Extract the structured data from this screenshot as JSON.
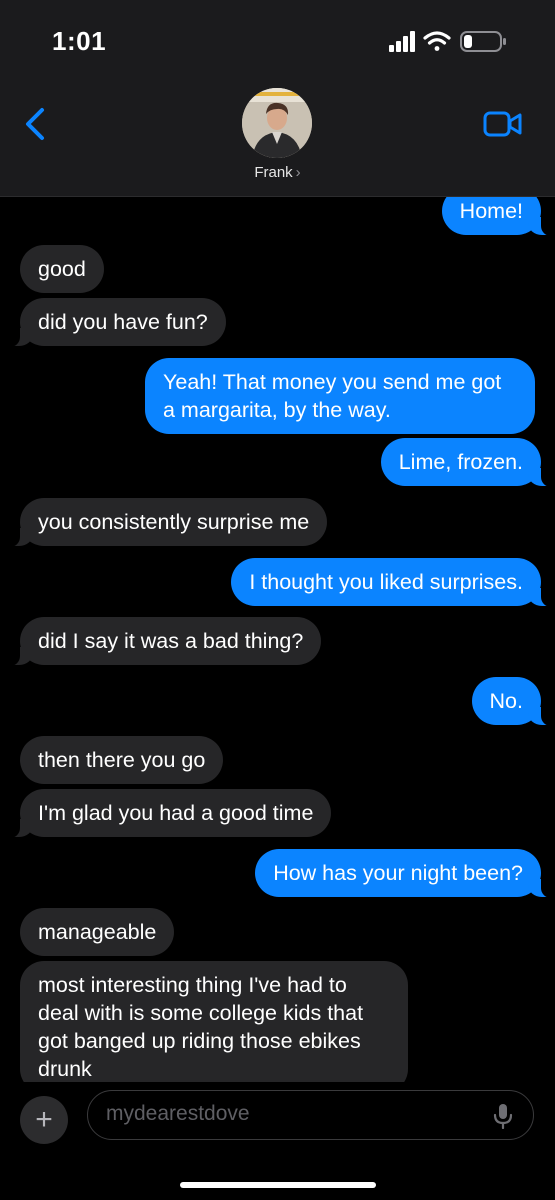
{
  "status_bar": {
    "time": "1:01",
    "icons": [
      "cellular-signal-icon",
      "wifi-icon",
      "battery-icon"
    ]
  },
  "header": {
    "back_icon": "chevron-left-icon",
    "contact_name": "Frank",
    "contact_chevron": "›",
    "video_icon": "video-camera-icon",
    "accent_color": "#0b84ff"
  },
  "messages": [
    {
      "from": "me",
      "text": "Home!"
    },
    {
      "from": "them",
      "text": "good"
    },
    {
      "from": "them",
      "text": "did you have fun?"
    },
    {
      "from": "me",
      "text": "Yeah! That money you send me got a margarita, by the way."
    },
    {
      "from": "me",
      "text": "Lime, frozen."
    },
    {
      "from": "them",
      "text": "you consistently surprise me"
    },
    {
      "from": "me",
      "text": "I thought you liked surprises."
    },
    {
      "from": "them",
      "text": "did I say it was a bad thing?"
    },
    {
      "from": "me",
      "text": "No."
    },
    {
      "from": "them",
      "text": "then there you go"
    },
    {
      "from": "them",
      "text": "I'm glad you had a good time"
    },
    {
      "from": "me",
      "text": "How has your night been?"
    },
    {
      "from": "them",
      "text": "manageable"
    },
    {
      "from": "them",
      "text": "most interesting thing I've had to deal with is some college kids that got banged up riding those ebikes drunk"
    }
  ],
  "compose": {
    "plus_label": "+",
    "placeholder": "mydearestdove",
    "mic_icon": "microphone-icon"
  },
  "colors": {
    "incoming_bubble": "#262628",
    "outgoing_bubble": "#0b84ff",
    "background": "#000000"
  }
}
